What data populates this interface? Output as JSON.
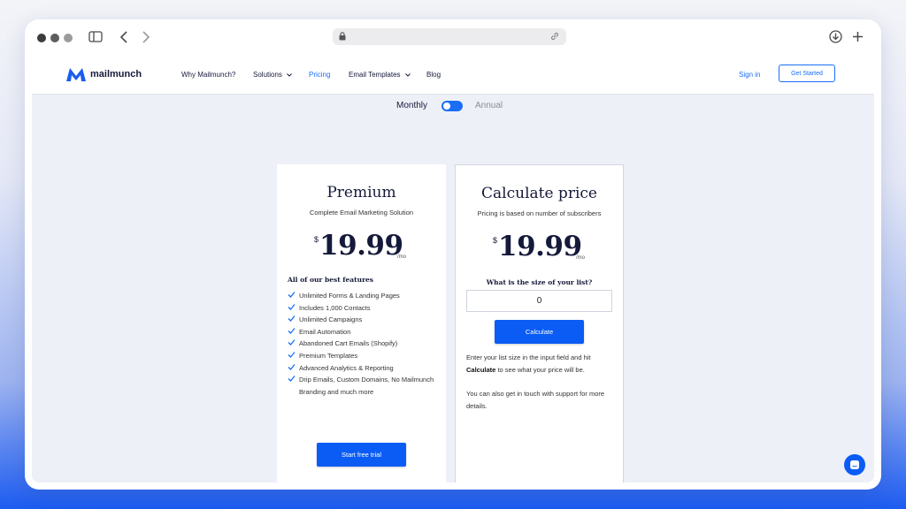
{
  "colors": {
    "accent": "#1a6ef5",
    "button": "#0b5cf5",
    "dot_dark": "#3c3c3e",
    "dot_gray": "#9b9b9e"
  },
  "browser": {
    "icons": [
      "sidebar-icon",
      "back-icon",
      "forward-icon",
      "lock-icon",
      "link-icon",
      "download-icon",
      "new-tab-icon"
    ]
  },
  "header": {
    "logo_text": "mailmunch",
    "nav": [
      {
        "label": "Why Mailmunch?"
      },
      {
        "label": "Solutions",
        "has_dropdown": true
      },
      {
        "label": "Pricing",
        "active": true
      },
      {
        "label": "Email Templates",
        "has_dropdown": true
      },
      {
        "label": "Blog"
      }
    ],
    "sign_in": "Sign in",
    "get_started": "Get Started"
  },
  "billing_toggle": {
    "monthly": "Monthly",
    "annual": "Annual",
    "selected": "Monthly"
  },
  "premium": {
    "title": "Premium",
    "subtitle": "Complete Email Marketing Solution",
    "currency": "$",
    "price": "19.99",
    "unit": "/mo",
    "features_heading": "All of our best features",
    "features": [
      "Unlimited Forms & Landing Pages",
      "Includes 1,000 Contacts",
      "Unlimited Campaigns",
      "Email Automation",
      "Abandoned Cart Emails (Shopify)",
      "Premium Templates",
      "Advanced Analytics & Reporting",
      "Drip Emails, Custom Domains, No Mailmunch Branding and much more"
    ],
    "cta": "Start free trial"
  },
  "calculator": {
    "title": "Calculate price",
    "subtitle": "Pricing is based on number of subscribers",
    "currency": "$",
    "price": "19.99",
    "unit": "/mo",
    "question": "What is the size of your list?",
    "input_value": "0",
    "button": "Calculate",
    "note1_a": "Enter your list size in the input field and hit ",
    "note1_b": "Calculate",
    "note1_c": " to see what your price will be.",
    "note2": "You can also get in touch with support for more details."
  }
}
